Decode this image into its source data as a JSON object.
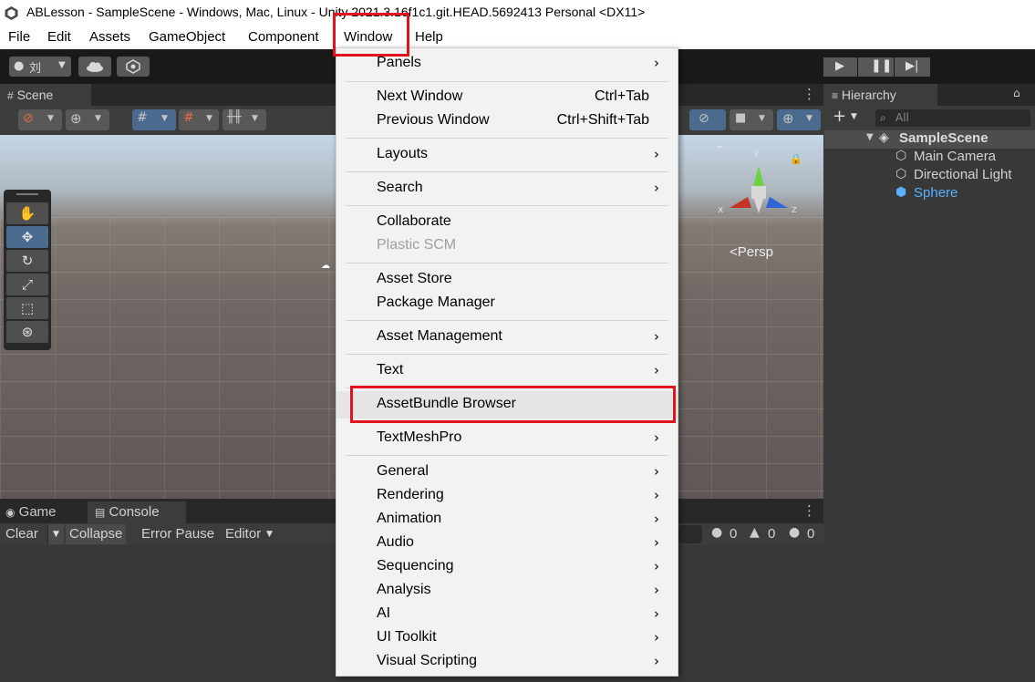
{
  "window": {
    "title": "ABLesson - SampleScene - Windows, Mac, Linux - Unity 2021.3.16f1c1.git.HEAD.5692413 Personal <DX11>"
  },
  "menubar": {
    "items": [
      "File",
      "Edit",
      "Assets",
      "GameObject",
      "Component",
      "Window",
      "Help"
    ]
  },
  "toolbar": {
    "account_label": "刘"
  },
  "scene": {
    "tab_label": "Scene",
    "persp_label": "<Persp",
    "axis_x": "x",
    "axis_y": "y",
    "axis_z": "z"
  },
  "hierarchy": {
    "tab_label": "Hierarchy",
    "search_placeholder": "All",
    "scene_name": "SampleScene",
    "objects": [
      "Main Camera",
      "Directional Light",
      "Sphere"
    ]
  },
  "console": {
    "tabs": [
      "Game",
      "Console"
    ],
    "buttons": [
      "Clear",
      "Collapse",
      "Error Pause",
      "Editor"
    ],
    "counts": {
      "info": "0",
      "warning": "0",
      "error": "0"
    }
  },
  "window_menu": {
    "items": [
      {
        "label": "Panels",
        "shortcut": "",
        "submenu": true,
        "disabled": false
      },
      {
        "label": "Next Window",
        "shortcut": "Ctrl+Tab",
        "submenu": false,
        "disabled": false
      },
      {
        "label": "Previous Window",
        "shortcut": "Ctrl+Shift+Tab",
        "submenu": false,
        "disabled": false
      },
      {
        "label": "Layouts",
        "shortcut": "",
        "submenu": true,
        "disabled": false
      },
      {
        "label": "Search",
        "shortcut": "",
        "submenu": true,
        "disabled": false
      },
      {
        "label": "Collaborate",
        "shortcut": "",
        "submenu": false,
        "disabled": false
      },
      {
        "label": "Plastic SCM",
        "shortcut": "",
        "submenu": false,
        "disabled": true
      },
      {
        "label": "Asset Store",
        "shortcut": "",
        "submenu": false,
        "disabled": false
      },
      {
        "label": "Package Manager",
        "shortcut": "",
        "submenu": false,
        "disabled": false
      },
      {
        "label": "Asset Management",
        "shortcut": "",
        "submenu": true,
        "disabled": false
      },
      {
        "label": "Text",
        "shortcut": "",
        "submenu": true,
        "disabled": false
      },
      {
        "label": "AssetBundle Browser",
        "shortcut": "",
        "submenu": false,
        "disabled": false,
        "highlighted": true
      },
      {
        "label": "TextMeshPro",
        "shortcut": "",
        "submenu": true,
        "disabled": false
      },
      {
        "label": "General",
        "shortcut": "",
        "submenu": true,
        "disabled": false
      },
      {
        "label": "Rendering",
        "shortcut": "",
        "submenu": true,
        "disabled": false
      },
      {
        "label": "Animation",
        "shortcut": "",
        "submenu": true,
        "disabled": false
      },
      {
        "label": "Audio",
        "shortcut": "",
        "submenu": true,
        "disabled": false
      },
      {
        "label": "Sequencing",
        "shortcut": "",
        "submenu": true,
        "disabled": false
      },
      {
        "label": "Analysis",
        "shortcut": "",
        "submenu": true,
        "disabled": false
      },
      {
        "label": "AI",
        "shortcut": "",
        "submenu": true,
        "disabled": false
      },
      {
        "label": "UI Toolkit",
        "shortcut": "",
        "submenu": true,
        "disabled": false
      },
      {
        "label": "Visual Scripting",
        "shortcut": "",
        "submenu": true,
        "disabled": false
      }
    ],
    "submenu_arrow": "›"
  },
  "colors": {
    "highlight_box": "#e0141e",
    "selected_object": "#5bb0ff"
  }
}
